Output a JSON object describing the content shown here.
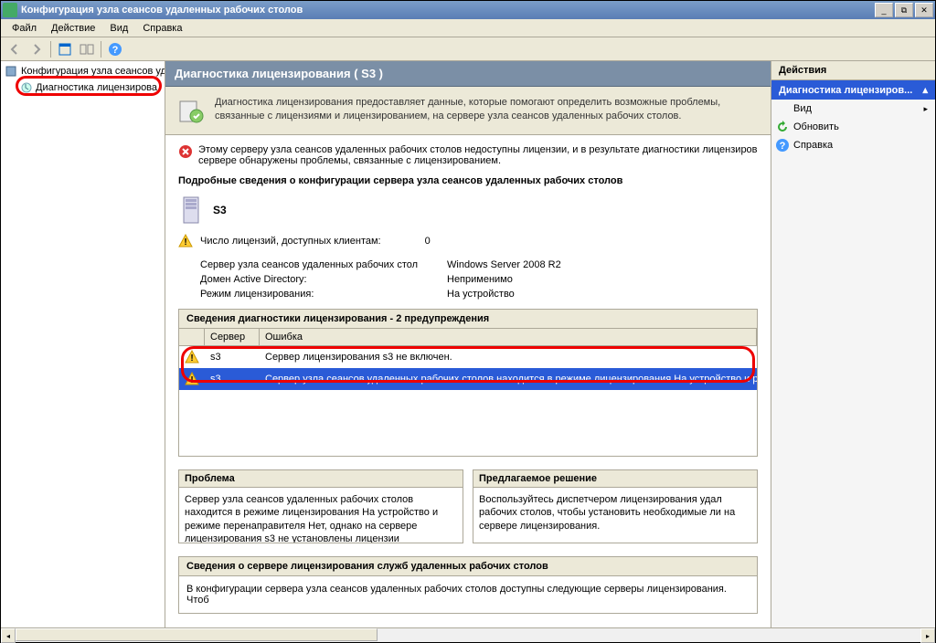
{
  "window": {
    "title": "Конфигурация узла сеансов удаленных рабочих столов"
  },
  "menu": {
    "file": "Файл",
    "action": "Действие",
    "view": "Вид",
    "help": "Справка"
  },
  "tree": {
    "root": "Конфигурация узла сеансов уд",
    "child": "Диагностика лицензирова"
  },
  "header": {
    "title": "Диагностика лицензирования ( S3 )"
  },
  "info": {
    "text": "Диагностика лицензирования предоставляет данные, которые помогают определить возможные проблемы, связанные с лицензиями и лицензированием, на сервере узла сеансов удаленных рабочих столов."
  },
  "error": {
    "text": "Этому серверу узла сеансов удаленных рабочих столов недоступны лицензии, и в результате диагностики лицензиров сервере обнаружены проблемы, связанные с лицензированием."
  },
  "section": {
    "config_title": "Подробные сведения о конфигурации сервера узла сеансов удаленных рабочих столов",
    "server_name": "S3"
  },
  "warn": {
    "licenses_label": "Число лицензий, доступных клиентам:",
    "licenses_value": "0"
  },
  "details": {
    "r1_label": "Сервер узла сеансов удаленных рабочих стол",
    "r1_value": "Windows Server 2008 R2",
    "r2_label": "Домен Active Directory:",
    "r2_value": "Неприменимо",
    "r3_label": "Режим лицензирования:",
    "r3_value": "На устройство"
  },
  "diag": {
    "header": "Сведения диагностики лицензирования - 2 предупреждения",
    "th_server": "Сервер",
    "th_error": "Ошибка",
    "rows": [
      {
        "server": "s3",
        "error": "Сервер лицензирования s3 не включен."
      },
      {
        "server": "s3",
        "error": "Сервер узла сеансов удаленных рабочих столов находится в режиме лицензирования На устройство и р"
      }
    ]
  },
  "problem": {
    "title": "Проблема",
    "text": "Сервер узла сеансов удаленных рабочих столов находится в режиме лицензирования На устройство и режиме перенаправителя Нет, однако на сервере лицензирования s3 не установлены лицензии установлено со следующими"
  },
  "solution": {
    "title": "Предлагаемое решение",
    "text": "Воспользуйтесь диспетчером лицензирования удал рабочих столов, чтобы установить необходимые ли на сервере лицензирования."
  },
  "license_section": {
    "title": "Сведения о сервере лицензирования служб удаленных рабочих столов",
    "body": "В конфигурации сервера узла сеансов удаленных рабочих столов доступны следующие серверы лицензирования. Чтоб"
  },
  "actions": {
    "title": "Действия",
    "subtitle": "Диагностика лицензиров...",
    "view": "Вид",
    "refresh": "Обновить",
    "help": "Справка"
  }
}
